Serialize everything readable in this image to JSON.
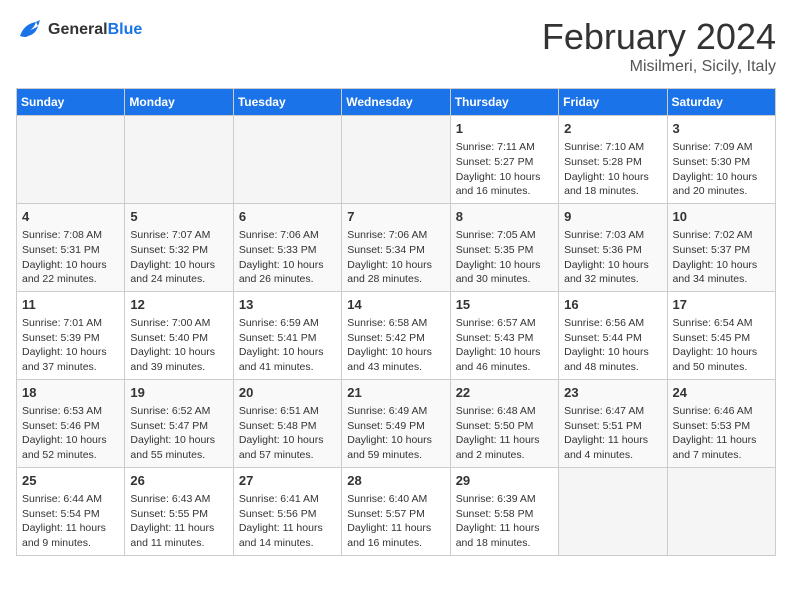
{
  "logo": {
    "line1": "General",
    "line2": "Blue"
  },
  "title": "February 2024",
  "location": "Misilmeri, Sicily, Italy",
  "days_of_week": [
    "Sunday",
    "Monday",
    "Tuesday",
    "Wednesday",
    "Thursday",
    "Friday",
    "Saturday"
  ],
  "weeks": [
    [
      {
        "day": "",
        "info": ""
      },
      {
        "day": "",
        "info": ""
      },
      {
        "day": "",
        "info": ""
      },
      {
        "day": "",
        "info": ""
      },
      {
        "day": "1",
        "info": "Sunrise: 7:11 AM\nSunset: 5:27 PM\nDaylight: 10 hours\nand 16 minutes."
      },
      {
        "day": "2",
        "info": "Sunrise: 7:10 AM\nSunset: 5:28 PM\nDaylight: 10 hours\nand 18 minutes."
      },
      {
        "day": "3",
        "info": "Sunrise: 7:09 AM\nSunset: 5:30 PM\nDaylight: 10 hours\nand 20 minutes."
      }
    ],
    [
      {
        "day": "4",
        "info": "Sunrise: 7:08 AM\nSunset: 5:31 PM\nDaylight: 10 hours\nand 22 minutes."
      },
      {
        "day": "5",
        "info": "Sunrise: 7:07 AM\nSunset: 5:32 PM\nDaylight: 10 hours\nand 24 minutes."
      },
      {
        "day": "6",
        "info": "Sunrise: 7:06 AM\nSunset: 5:33 PM\nDaylight: 10 hours\nand 26 minutes."
      },
      {
        "day": "7",
        "info": "Sunrise: 7:06 AM\nSunset: 5:34 PM\nDaylight: 10 hours\nand 28 minutes."
      },
      {
        "day": "8",
        "info": "Sunrise: 7:05 AM\nSunset: 5:35 PM\nDaylight: 10 hours\nand 30 minutes."
      },
      {
        "day": "9",
        "info": "Sunrise: 7:03 AM\nSunset: 5:36 PM\nDaylight: 10 hours\nand 32 minutes."
      },
      {
        "day": "10",
        "info": "Sunrise: 7:02 AM\nSunset: 5:37 PM\nDaylight: 10 hours\nand 34 minutes."
      }
    ],
    [
      {
        "day": "11",
        "info": "Sunrise: 7:01 AM\nSunset: 5:39 PM\nDaylight: 10 hours\nand 37 minutes."
      },
      {
        "day": "12",
        "info": "Sunrise: 7:00 AM\nSunset: 5:40 PM\nDaylight: 10 hours\nand 39 minutes."
      },
      {
        "day": "13",
        "info": "Sunrise: 6:59 AM\nSunset: 5:41 PM\nDaylight: 10 hours\nand 41 minutes."
      },
      {
        "day": "14",
        "info": "Sunrise: 6:58 AM\nSunset: 5:42 PM\nDaylight: 10 hours\nand 43 minutes."
      },
      {
        "day": "15",
        "info": "Sunrise: 6:57 AM\nSunset: 5:43 PM\nDaylight: 10 hours\nand 46 minutes."
      },
      {
        "day": "16",
        "info": "Sunrise: 6:56 AM\nSunset: 5:44 PM\nDaylight: 10 hours\nand 48 minutes."
      },
      {
        "day": "17",
        "info": "Sunrise: 6:54 AM\nSunset: 5:45 PM\nDaylight: 10 hours\nand 50 minutes."
      }
    ],
    [
      {
        "day": "18",
        "info": "Sunrise: 6:53 AM\nSunset: 5:46 PM\nDaylight: 10 hours\nand 52 minutes."
      },
      {
        "day": "19",
        "info": "Sunrise: 6:52 AM\nSunset: 5:47 PM\nDaylight: 10 hours\nand 55 minutes."
      },
      {
        "day": "20",
        "info": "Sunrise: 6:51 AM\nSunset: 5:48 PM\nDaylight: 10 hours\nand 57 minutes."
      },
      {
        "day": "21",
        "info": "Sunrise: 6:49 AM\nSunset: 5:49 PM\nDaylight: 10 hours\nand 59 minutes."
      },
      {
        "day": "22",
        "info": "Sunrise: 6:48 AM\nSunset: 5:50 PM\nDaylight: 11 hours\nand 2 minutes."
      },
      {
        "day": "23",
        "info": "Sunrise: 6:47 AM\nSunset: 5:51 PM\nDaylight: 11 hours\nand 4 minutes."
      },
      {
        "day": "24",
        "info": "Sunrise: 6:46 AM\nSunset: 5:53 PM\nDaylight: 11 hours\nand 7 minutes."
      }
    ],
    [
      {
        "day": "25",
        "info": "Sunrise: 6:44 AM\nSunset: 5:54 PM\nDaylight: 11 hours\nand 9 minutes."
      },
      {
        "day": "26",
        "info": "Sunrise: 6:43 AM\nSunset: 5:55 PM\nDaylight: 11 hours\nand 11 minutes."
      },
      {
        "day": "27",
        "info": "Sunrise: 6:41 AM\nSunset: 5:56 PM\nDaylight: 11 hours\nand 14 minutes."
      },
      {
        "day": "28",
        "info": "Sunrise: 6:40 AM\nSunset: 5:57 PM\nDaylight: 11 hours\nand 16 minutes."
      },
      {
        "day": "29",
        "info": "Sunrise: 6:39 AM\nSunset: 5:58 PM\nDaylight: 11 hours\nand 18 minutes."
      },
      {
        "day": "",
        "info": ""
      },
      {
        "day": "",
        "info": ""
      }
    ]
  ]
}
